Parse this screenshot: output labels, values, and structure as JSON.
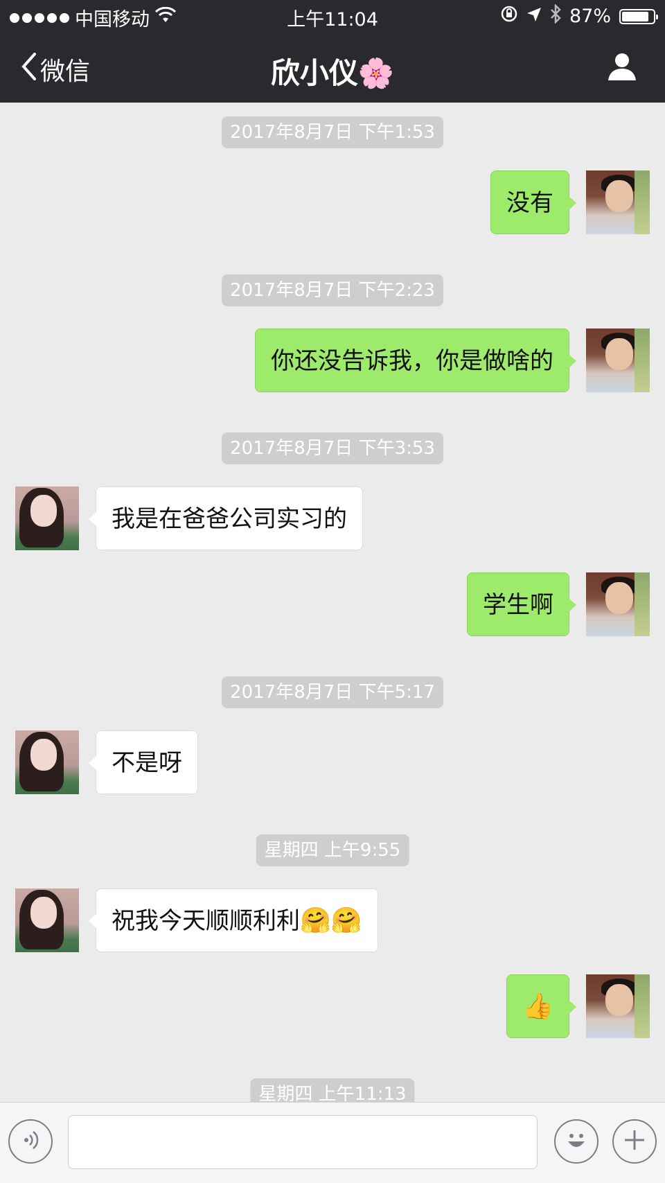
{
  "status_bar": {
    "carrier": "中国移动",
    "time": "上午11:04",
    "battery_text": "87%",
    "battery_level": 0.87
  },
  "nav": {
    "back_label": "微信",
    "title": "欣小仪",
    "title_emoji": "🌸"
  },
  "messages": {
    "t1": "2017年8月7日 下午1:53",
    "m1": "没有",
    "t2": "2017年8月7日 下午2:23",
    "m2": "你还没告诉我，你是做啥的",
    "t3": "2017年8月7日 下午3:53",
    "m3": "我是在爸爸公司实习的",
    "m4": "学生啊",
    "t4": "2017年8月7日 下午5:17",
    "m5": "不是呀",
    "t5": "星期四 上午9:55",
    "m6": "祝我今天顺顺利利",
    "m6_emoji": "🤗🤗",
    "m7": "👍",
    "t6": "星期四 上午11:13"
  },
  "input_bar": {
    "text_value": "",
    "voice_icon": "voice-icon",
    "emoji_icon": "smiley-icon",
    "add_icon": "plus-icon"
  },
  "colors": {
    "header_bg": "#2a292e",
    "chat_bg": "#ebebeb",
    "my_bubble": "#9eea6a",
    "their_bubble": "#ffffff",
    "time_chip": "#cecece"
  }
}
